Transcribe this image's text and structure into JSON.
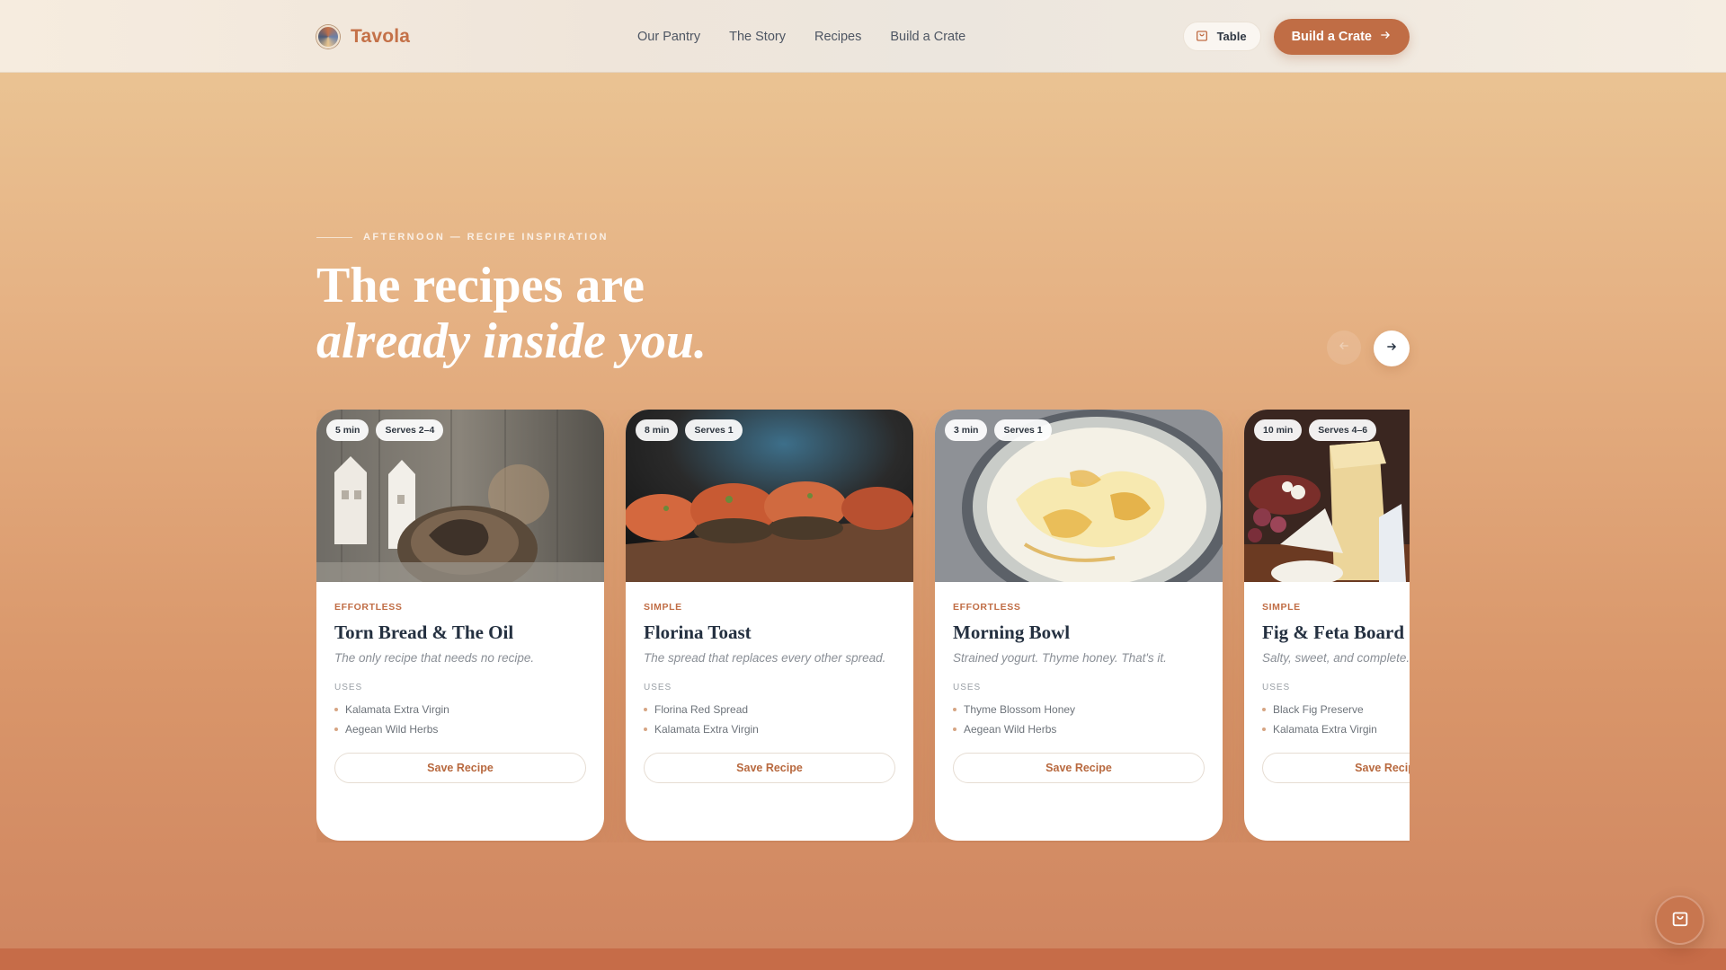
{
  "brand": {
    "name": "Tavola"
  },
  "nav": {
    "links": [
      "Our Pantry",
      "The Story",
      "Recipes",
      "Build a Crate"
    ],
    "table_label": "Table",
    "cta_label": "Build a Crate"
  },
  "hero": {
    "eyebrow": "AFTERNOON — RECIPE INSPIRATION",
    "title_line1": "The recipes are",
    "title_line2": "already inside you."
  },
  "colors": {
    "accent": "#c06d45",
    "heading": "#243040"
  },
  "cards": [
    {
      "time": "5 min",
      "serves": "Serves 2–4",
      "tag": "EFFORTLESS",
      "title": "Torn Bread & The Oil",
      "desc": "The only recipe that needs no recipe.",
      "uses_label": "USES",
      "uses": [
        "Kalamata Extra Virgin",
        "Aegean Wild Herbs"
      ],
      "save": "Save Recipe"
    },
    {
      "time": "8 min",
      "serves": "Serves 1",
      "tag": "SIMPLE",
      "title": "Florina Toast",
      "desc": "The spread that replaces every other spread.",
      "uses_label": "USES",
      "uses": [
        "Florina Red Spread",
        "Kalamata Extra Virgin"
      ],
      "save": "Save Recipe"
    },
    {
      "time": "3 min",
      "serves": "Serves 1",
      "tag": "EFFORTLESS",
      "title": "Morning Bowl",
      "desc": "Strained yogurt. Thyme honey. That's it.",
      "uses_label": "USES",
      "uses": [
        "Thyme Blossom Honey",
        "Aegean Wild Herbs"
      ],
      "save": "Save Recipe"
    },
    {
      "time": "10 min",
      "serves": "Serves 4–6",
      "tag": "SIMPLE",
      "title": "Fig & Feta Board",
      "desc": "Salty, sweet, and complete.",
      "uses_label": "USES",
      "uses": [
        "Black Fig Preserve",
        "Kalamata Extra Virgin"
      ],
      "save": "Save Recipe"
    }
  ]
}
